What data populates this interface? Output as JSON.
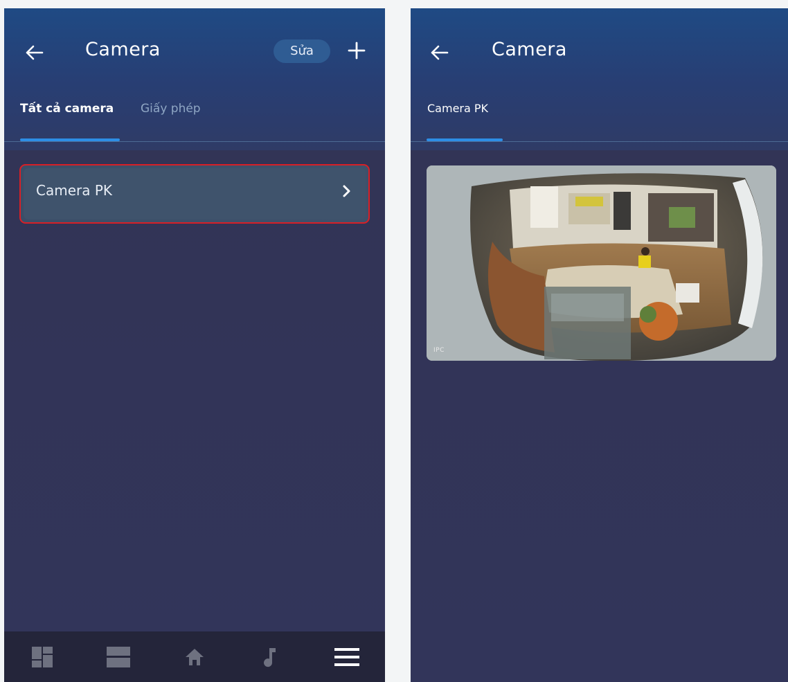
{
  "left_screen": {
    "header": {
      "back_icon": "arrow-left-icon",
      "title": "Camera",
      "edit_label": "Sửa",
      "add_icon": "plus-icon"
    },
    "tabs": [
      {
        "label": "Tất cả camera",
        "active": true
      },
      {
        "label": "Giấy phép",
        "active": false
      }
    ],
    "camera_list": [
      {
        "name": "Camera PK",
        "icon": "chevron-right-icon",
        "highlighted": true
      }
    ],
    "bottom_nav": [
      "dashboard-icon",
      "rooms-icon",
      "home-icon",
      "music-icon",
      "menu-icon"
    ]
  },
  "right_screen": {
    "header": {
      "back_icon": "arrow-left-icon",
      "title": "Camera"
    },
    "tabs": [
      {
        "label": "Camera PK",
        "active": true
      }
    ],
    "feed": {
      "watermark": "IPC"
    }
  },
  "colors": {
    "accent": "#2d8ee6",
    "highlight_border": "#d81f26",
    "background": "#32355a"
  }
}
